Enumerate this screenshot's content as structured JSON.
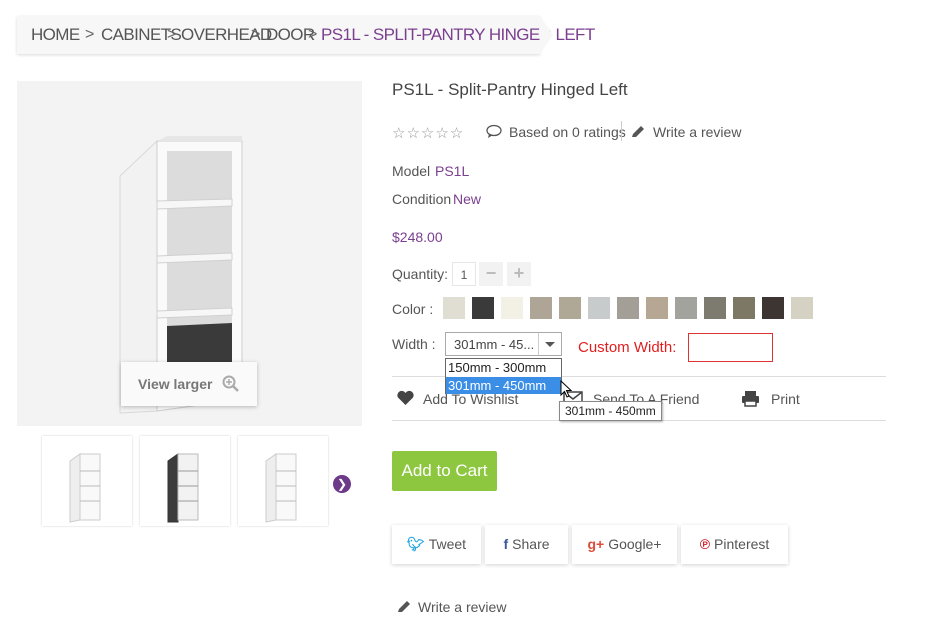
{
  "breadcrumb": {
    "items": [
      "HOME",
      "CABINETS",
      "OVERHEAD",
      "DOOR"
    ],
    "current": "PS1L - SPLIT-PANTRY HINGED LEFT",
    "separator": ">"
  },
  "gallery": {
    "view_larger": "View larger",
    "icons": [
      "zoom-icon",
      "next-arrow-icon"
    ]
  },
  "product": {
    "title": "PS1L - Split-Pantry Hinged Left",
    "rating_text": "Based on 0 ratings",
    "write_review": "Write a review",
    "model_label": "Model",
    "model_value": "PS1L",
    "condition_label": "Condition",
    "condition_value": "New",
    "price": "$248.00",
    "quantity_label": "Quantity:",
    "quantity_value": "1",
    "color_label": "Color :",
    "colors": [
      "#e0ddd3",
      "#3a3a3a",
      "#f3f1e6",
      "#aea597",
      "#b0a897",
      "#c8cbcb",
      "#a39f97",
      "#b5a793",
      "#a2a39d",
      "#7d7a70",
      "#7c7865",
      "#3d3532",
      "#d5d2c3"
    ],
    "width_label": "Width :",
    "width_selected": "301mm - 45...",
    "width_options": [
      "150mm - 300mm",
      "301mm - 450mm"
    ],
    "width_tooltip": "301mm - 450mm",
    "custom_width_label": "Custom Width:",
    "custom_width_value": ""
  },
  "actions": {
    "wishlist": "Add To Wishlist",
    "send_friend": "Send To A Friend",
    "print": "Print",
    "add_to_cart": "Add to Cart"
  },
  "social": {
    "tweet": "Tweet",
    "share": "Share",
    "google": "Google+",
    "pinterest": "Pinterest",
    "write_review": "Write a review"
  }
}
